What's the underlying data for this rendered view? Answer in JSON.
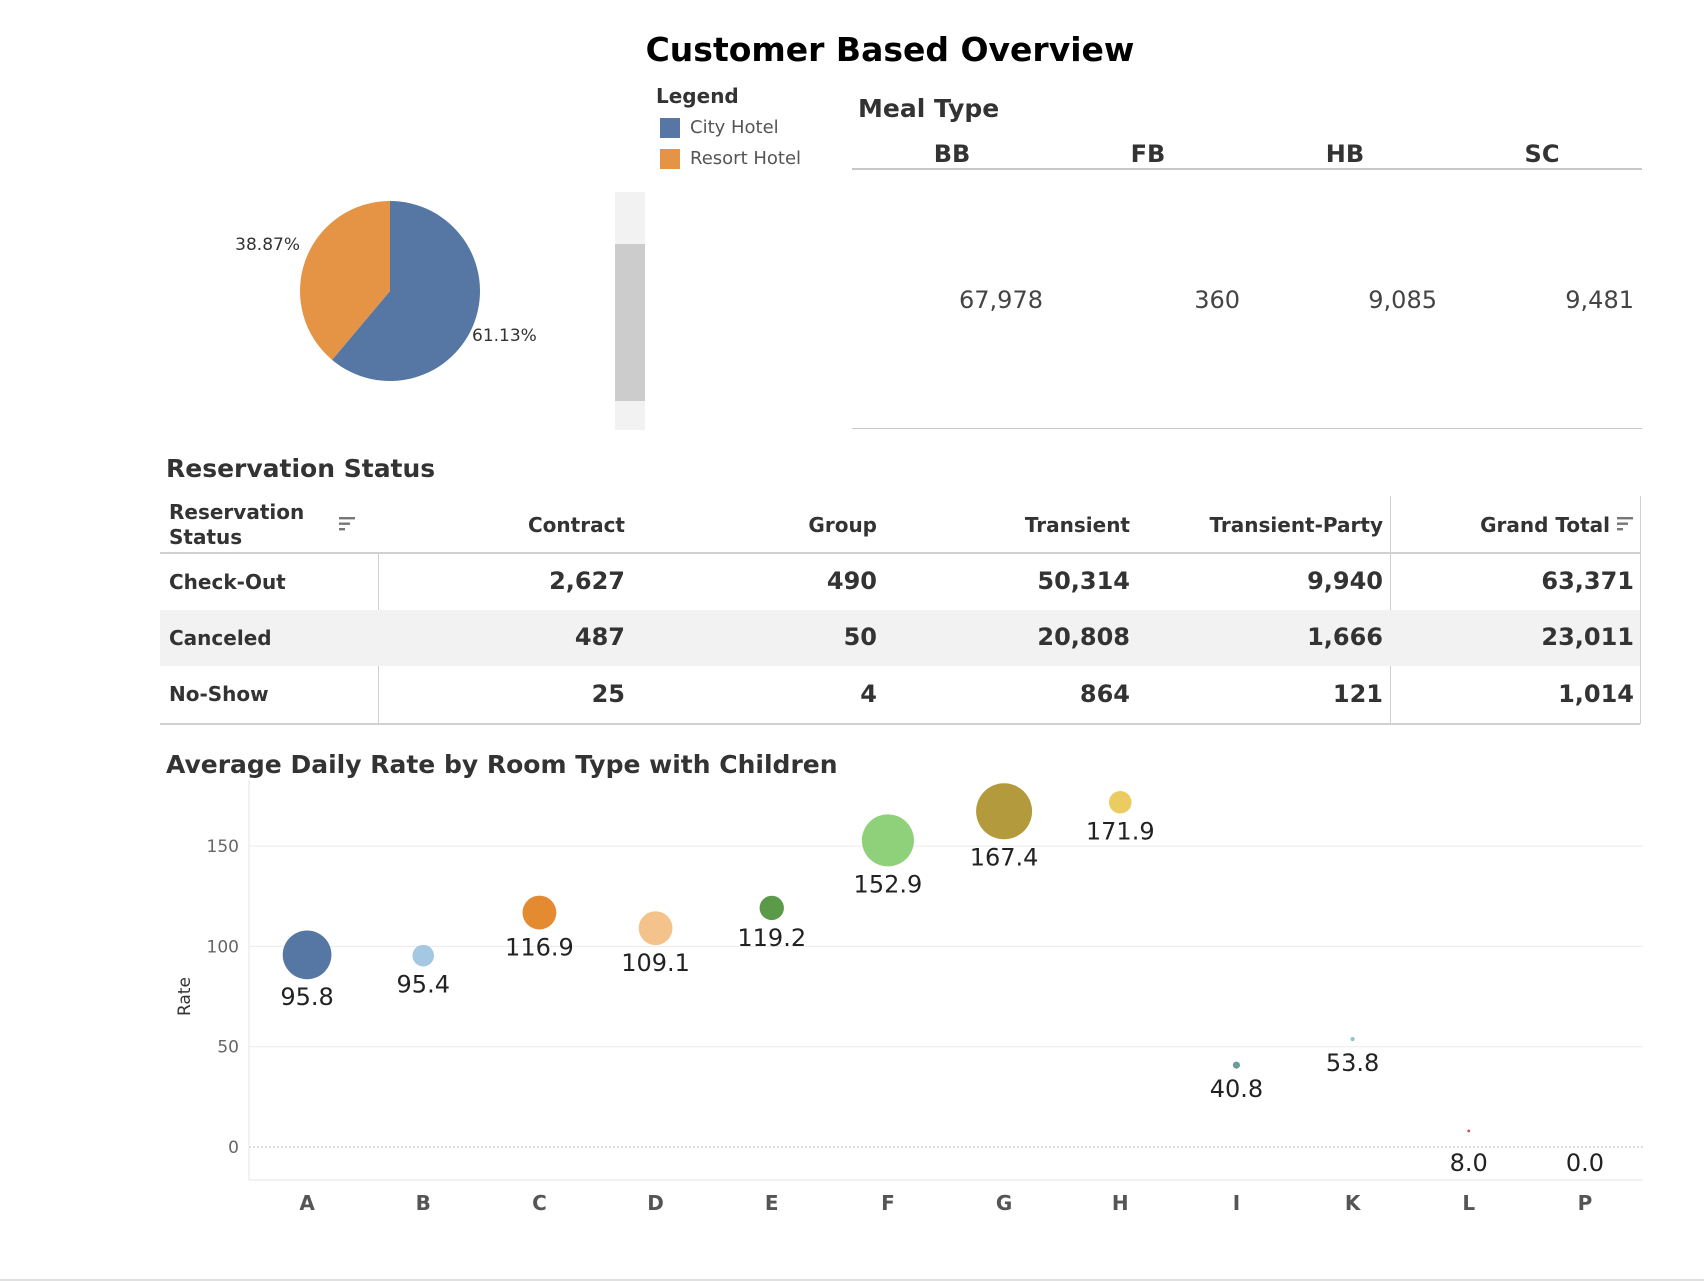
{
  "title": "Customer Based Overview",
  "legend": {
    "title": "Legend",
    "items": [
      {
        "label": "City Hotel",
        "color": "#5677a4"
      },
      {
        "label": "Resort Hotel",
        "color": "#e49444"
      }
    ]
  },
  "pie": {
    "slices": [
      {
        "label": "City Hotel",
        "pct_label": "61.13%",
        "value": 61.13,
        "color": "#5677a4"
      },
      {
        "label": "Resort Hotel",
        "pct_label": "38.87%",
        "value": 38.87,
        "color": "#e49444"
      }
    ]
  },
  "meal": {
    "title": "Meal Type",
    "columns": [
      "BB",
      "FB",
      "HB",
      "SC"
    ],
    "values": [
      "67,978",
      "360",
      "9,085",
      "9,481"
    ]
  },
  "reservation": {
    "title": "Reservation Status",
    "corner_label": "Reservation Status",
    "columns": [
      "Contract",
      "Group",
      "Transient",
      "Transient-Party",
      "Grand Total"
    ],
    "rows": [
      {
        "label": "Check-Out",
        "values": [
          "2,627",
          "490",
          "50,314",
          "9,940",
          "63,371"
        ]
      },
      {
        "label": "Canceled",
        "values": [
          "487",
          "50",
          "20,808",
          "1,666",
          "23,011"
        ]
      },
      {
        "label": "No-Show",
        "values": [
          "25",
          "4",
          "864",
          "121",
          "1,014"
        ]
      }
    ]
  },
  "chart_data": [
    {
      "type": "pie",
      "categories": [
        "City Hotel",
        "Resort Hotel"
      ],
      "values": [
        61.13,
        38.87
      ],
      "colors": [
        "#5677a4",
        "#e49444"
      ],
      "labels": [
        "61.13%",
        "38.87%"
      ]
    },
    {
      "type": "scatter",
      "title": "Average Daily Rate by Room Type with Children",
      "ylabel": "Rate",
      "xlabel": "",
      "ylim": [
        -8,
        183
      ],
      "yticks": [
        0,
        50,
        100,
        150
      ],
      "grid": true,
      "categories": [
        "A",
        "B",
        "C",
        "D",
        "E",
        "F",
        "G",
        "H",
        "I",
        "K",
        "L",
        "P"
      ],
      "values": [
        95.8,
        95.4,
        116.9,
        109.1,
        119.2,
        152.9,
        167.4,
        171.9,
        40.8,
        53.8,
        8.0,
        0.0
      ],
      "labels": [
        "95.8",
        "95.4",
        "116.9",
        "109.1",
        "119.2",
        "152.9",
        "167.4",
        "171.9",
        "40.8",
        "53.8",
        "8.0",
        "0.0"
      ],
      "sizes": [
        5600,
        1100,
        2700,
        2700,
        1400,
        6400,
        7400,
        1200,
        120,
        40,
        20,
        0
      ],
      "colors": [
        "#5677a4",
        "#a4c8e4",
        "#e48a31",
        "#f4c38c",
        "#5a9a48",
        "#8fd07a",
        "#b39a3c",
        "#ebcc60",
        "#6d9c9c",
        "#8fc6c0",
        "#d95450",
        "#888888"
      ]
    }
  ]
}
